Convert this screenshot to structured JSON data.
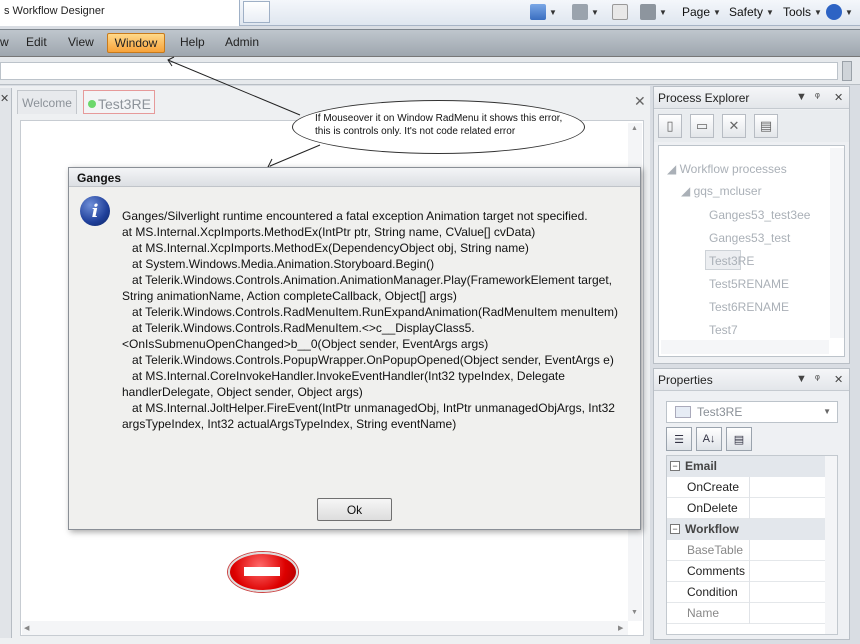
{
  "browser": {
    "tab_title": "s Workflow Designer",
    "tools": [
      "Page",
      "Safety",
      "Tools"
    ]
  },
  "menu": {
    "items": [
      "w",
      "Edit",
      "View",
      "Window",
      "Help",
      "Admin"
    ]
  },
  "doc_tabs": {
    "welcome": "Welcome",
    "active": "Test3RE"
  },
  "callout": {
    "text": "If Mouseover it on Window RadMenu it shows this error, this is controls only. It's not code related error"
  },
  "process_explorer": {
    "title": "Process Explorer",
    "tree": {
      "root": "Workflow processes",
      "user": "gqs_mcluser",
      "items": [
        "Ganges53_test3ee",
        "Ganges53_test",
        "Test3RE",
        "Test5RENAME",
        "Test6RENAME",
        "Test7"
      ],
      "selected": "Test3RE"
    }
  },
  "properties": {
    "title": "Properties",
    "selected_object": "Test3RE",
    "categories": [
      {
        "name": "Email",
        "rows": [
          "OnCreate",
          "OnDelete"
        ]
      },
      {
        "name": "Workflow",
        "rows": [
          "BaseTable",
          "Comments",
          "Condition",
          "Name"
        ]
      }
    ]
  },
  "dialog": {
    "title": "Ganges",
    "message": "Ganges/Silverlight runtime encountered a fatal exception Animation target not specified.\nat MS.Internal.XcpImports.MethodEx(IntPtr ptr, String name, CValue[] cvData)\n   at MS.Internal.XcpImports.MethodEx(DependencyObject obj, String name)\n   at System.Windows.Media.Animation.Storyboard.Begin()\n   at Telerik.Windows.Controls.Animation.AnimationManager.Play(FrameworkElement target, String animationName, Action completeCallback, Object[] args)\n   at Telerik.Windows.Controls.RadMenuItem.RunExpandAnimation(RadMenuItem menuItem)\n   at Telerik.Windows.Controls.RadMenuItem.<>c__DisplayClass5.<OnIsSubmenuOpenChanged>b__0(Object sender, EventArgs args)\n   at Telerik.Windows.Controls.PopupWrapper.OnPopupOpened(Object sender, EventArgs e)\n   at MS.Internal.CoreInvokeHandler.InvokeEventHandler(Int32 typeIndex, Delegate handlerDelegate, Object sender, Object args)\n   at MS.Internal.JoltHelper.FireEvent(IntPtr unmanagedObj, IntPtr unmanagedObjArgs, Int32 argsTypeIndex, Int32 actualArgsTypeIndex, String eventName)",
    "ok_label": "Ok"
  },
  "colors": {
    "menu_highlight": "#f7a23a",
    "stop_red": "#dd0000",
    "info_blue": "#1f3f9a"
  }
}
